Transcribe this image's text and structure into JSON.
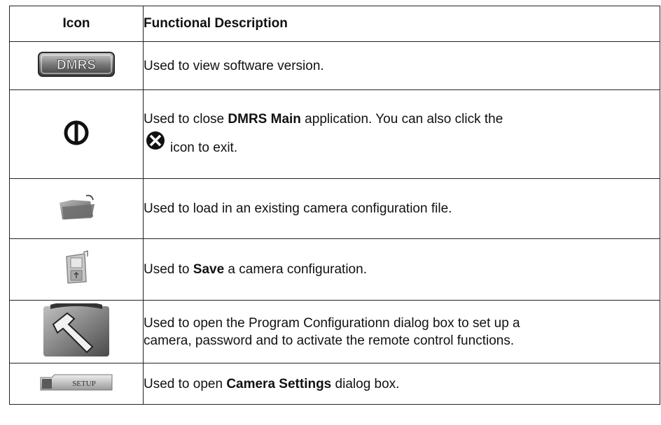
{
  "header": {
    "icon_col": "Icon",
    "desc_col": "Functional Description"
  },
  "rows": [
    {
      "icon_name": "dmrs-logo-icon",
      "icon_text": "DMRS",
      "desc": {
        "text": "Used to view software version."
      }
    },
    {
      "icon_name": "power-icon",
      "desc": {
        "pre": "Used to close ",
        "bold": "DMRS Main",
        "post": " application. You can also click the",
        "tail": "icon to exit.",
        "inline_icon": "close-x-icon"
      }
    },
    {
      "icon_name": "folder-open-icon",
      "desc": {
        "text": "Used to load in an existing camera configuration file."
      }
    },
    {
      "icon_name": "save-disk-icon",
      "desc": {
        "pre": "Used to ",
        "bold": "Save",
        "post": " a camera configuration."
      }
    },
    {
      "icon_name": "hammer-tool-icon",
      "desc": {
        "line1": "Used to open the Program Configurationn dialog box to set up a",
        "line2": "camera, password and to activate the remote control functions."
      }
    },
    {
      "icon_name": "setup-button-icon",
      "icon_text": "SETUP",
      "desc": {
        "pre": "Used to open ",
        "bold": "Camera Settings",
        "post": " dialog box."
      }
    }
  ]
}
